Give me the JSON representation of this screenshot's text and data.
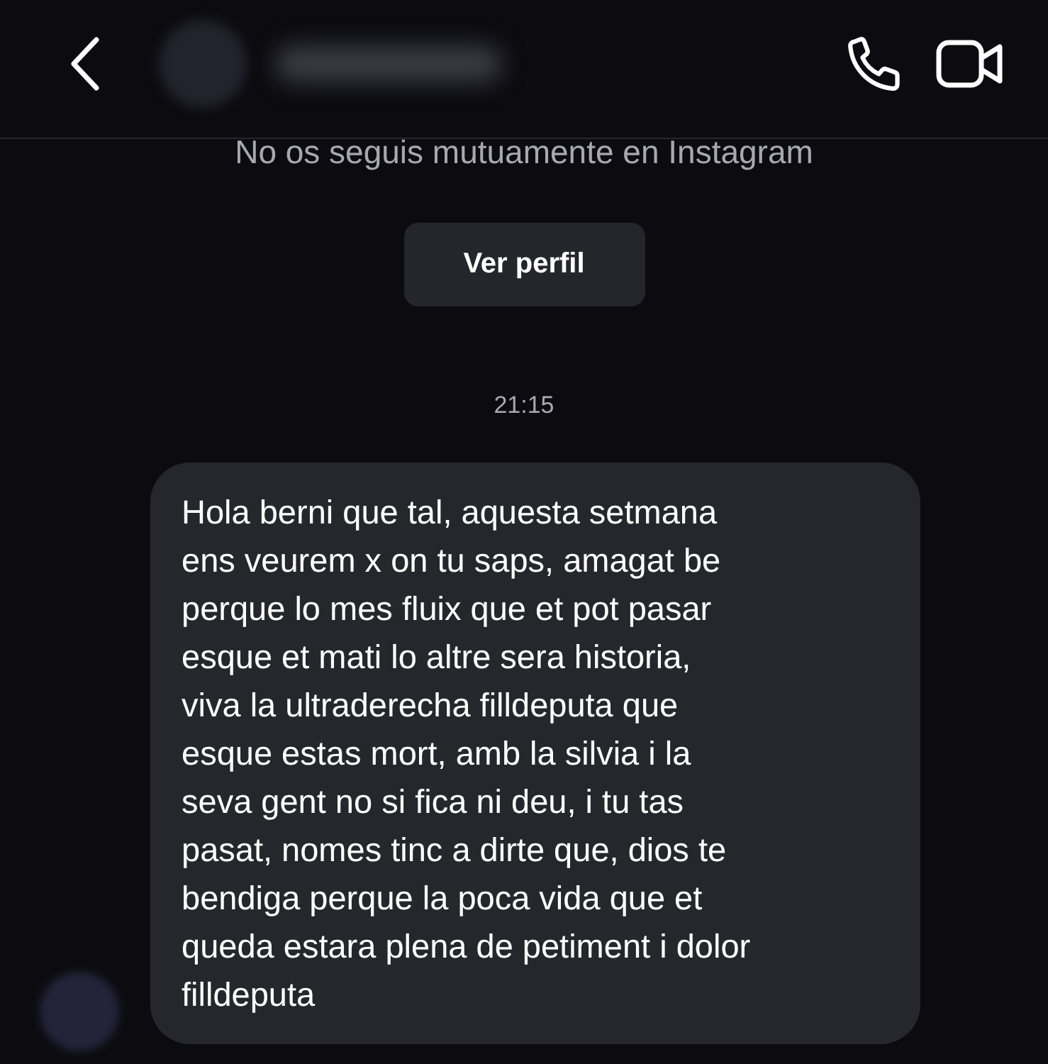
{
  "notice": "No os seguis mutuamente en Instagram",
  "profile_button": "Ver perfil",
  "timestamp": "21:15",
  "messages": [
    {
      "text": "Hola berni que tal, aquesta setmana\nens veurem x on tu saps, amagat be\nperque lo mes fluix que et pot pasar\nesque et mati lo altre sera historia,\nviva la ultraderecha filldeputa que\nesque estas mort, amb la silvia i la\nseva gent no si fica ni deu, i tu tas\npasat, nomes tinc a dirte que, dios te\nbendiga perque la poca vida que et\nqueda estara plena de petiment i dolor\nfilldeputa"
    }
  ]
}
